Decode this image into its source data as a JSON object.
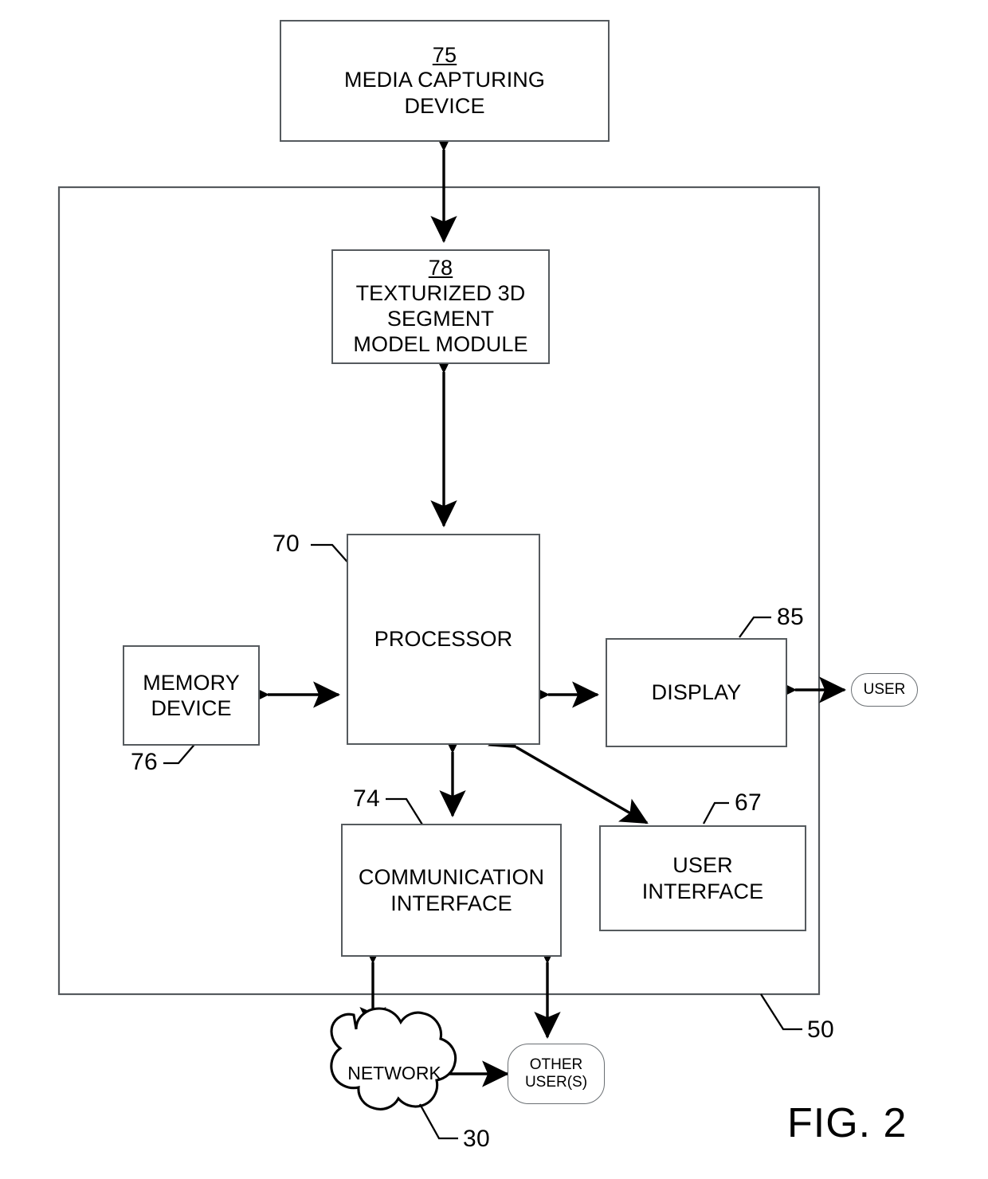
{
  "figure": {
    "label": "FIG. 2",
    "device_ref": "50"
  },
  "nodes": {
    "media_capturing_device": {
      "ref": "75",
      "label": "MEDIA CAPTURING\nDEVICE"
    },
    "texturized_module": {
      "ref": "78",
      "label": "TEXTURIZED 3D\nSEGMENT\nMODEL MODULE"
    },
    "processor": {
      "ref": "70",
      "label": "PROCESSOR"
    },
    "memory_device": {
      "ref": "76",
      "label": "MEMORY\nDEVICE"
    },
    "display": {
      "ref": "85",
      "label": "DISPLAY"
    },
    "communication_interface": {
      "ref": "74",
      "label": "COMMUNICATION\nINTERFACE"
    },
    "user_interface": {
      "ref": "67",
      "label": "USER\nINTERFACE"
    },
    "user_pill": {
      "label": "USER"
    },
    "other_users_pill": {
      "label": "OTHER\nUSER(S)"
    },
    "network_cloud": {
      "ref": "30",
      "label": "NETWORK"
    }
  },
  "colors": {
    "stroke": "#000000",
    "box_border": "#555a5e",
    "background": "#ffffff"
  }
}
